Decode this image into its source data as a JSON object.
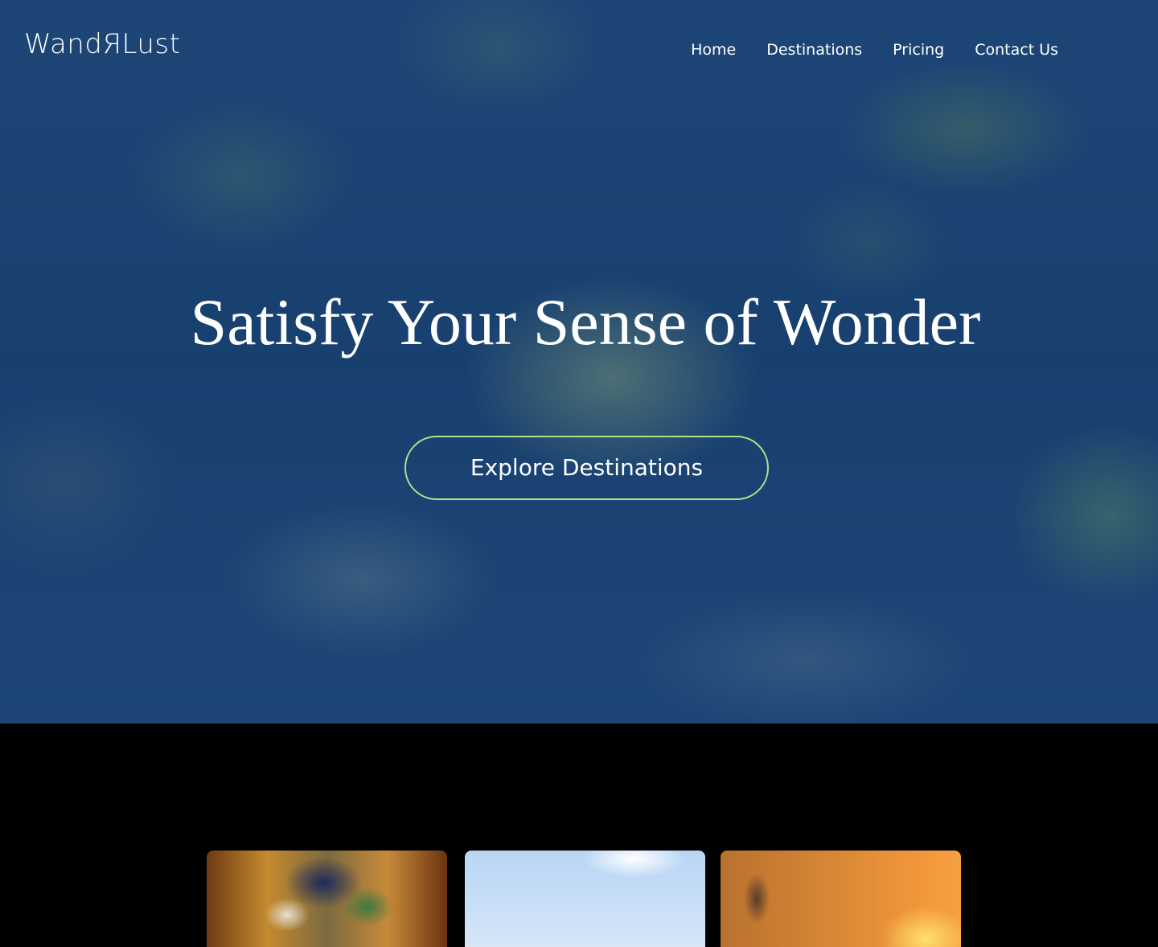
{
  "header": {
    "logo_text": "WandЯLust",
    "nav": [
      {
        "label": "Home"
      },
      {
        "label": "Destinations"
      },
      {
        "label": "Pricing"
      },
      {
        "label": "Contact Us"
      }
    ]
  },
  "hero": {
    "title": "Satisfy Your Sense of Wonder",
    "cta_label": "Explore Destinations",
    "cta_border_color": "#b5e08c",
    "background_color": "#1b4475"
  },
  "cards": {
    "items": [
      {
        "image": "blurred colorful market scene"
      },
      {
        "image": "blue sky"
      },
      {
        "image": "orange sunset"
      }
    ]
  }
}
